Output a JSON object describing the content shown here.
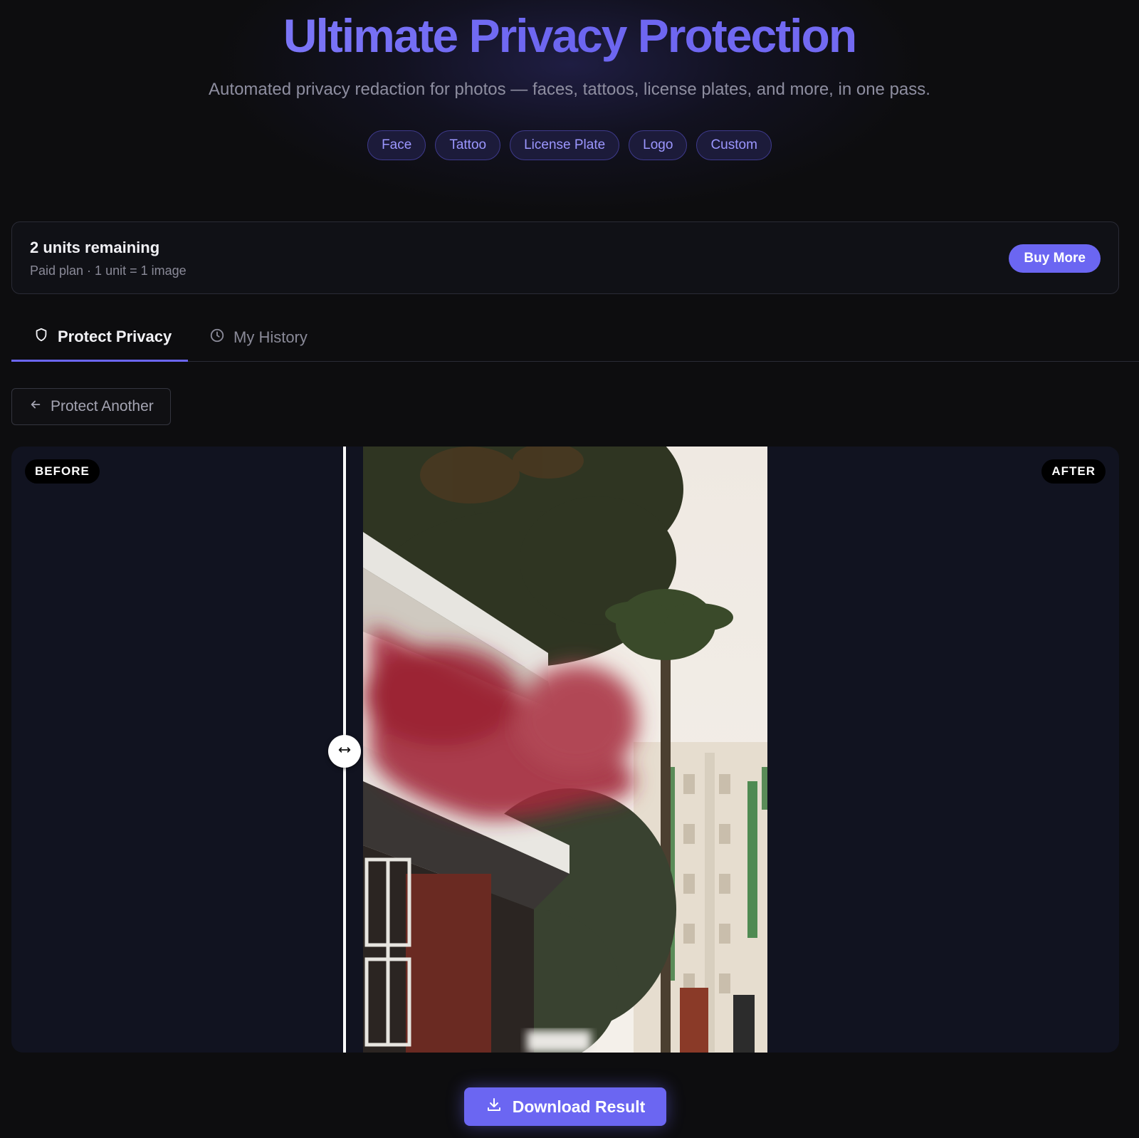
{
  "hero": {
    "title": "Ultimate Privacy Protection",
    "subtitle": "Automated privacy redaction for photos — faces, tattoos, license plates, and more, in one pass.",
    "tags": [
      "Face",
      "Tattoo",
      "License Plate",
      "Logo",
      "Custom"
    ]
  },
  "units": {
    "title": "2 units remaining",
    "subtitle": "Paid plan · 1 unit = 1 image",
    "buy_label": "Buy More"
  },
  "tabs": [
    {
      "label": "Protect Privacy",
      "icon": "shield-icon",
      "active": true
    },
    {
      "label": "My History",
      "icon": "clock-icon",
      "active": false
    }
  ],
  "back_button": {
    "label": "Protect Another"
  },
  "compare": {
    "before_label": "BEFORE",
    "after_label": "AFTER"
  },
  "download": {
    "label": "Download Result"
  },
  "colors": {
    "accent": "#6b66f2",
    "background": "#0d0d0f",
    "tag_text": "#9c97ff"
  }
}
